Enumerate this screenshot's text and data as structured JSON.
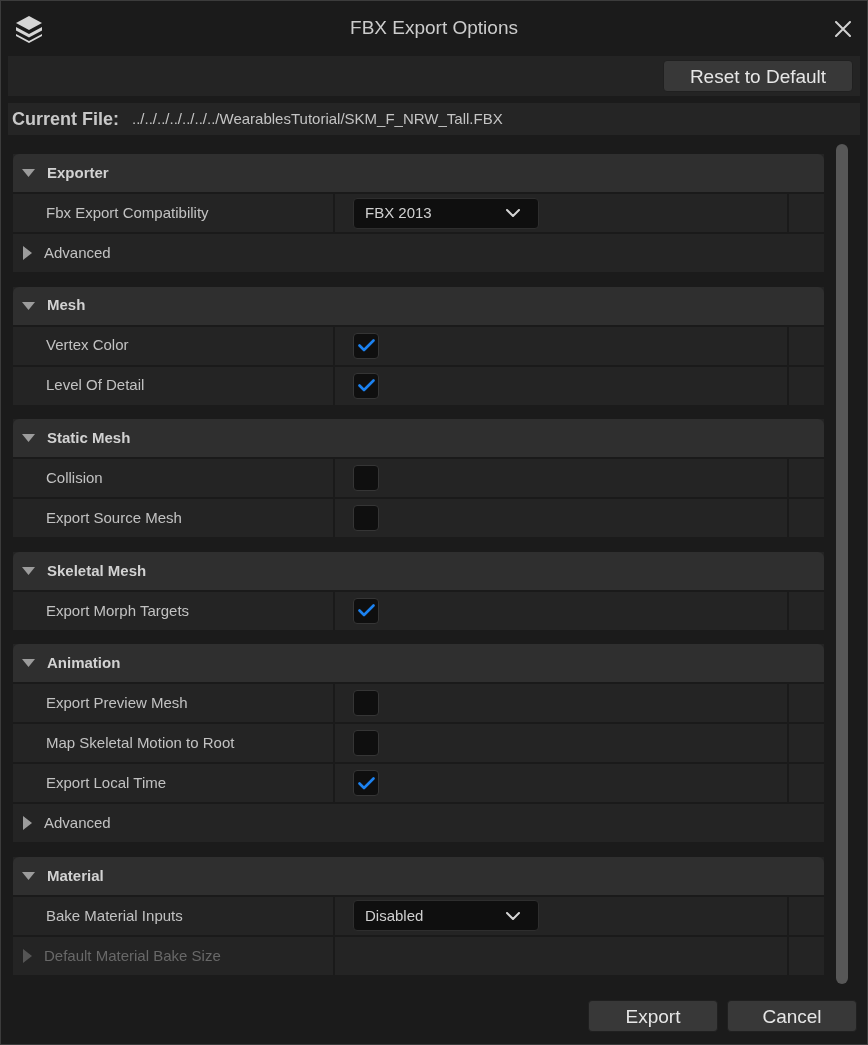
{
  "window": {
    "title": "FBX Export Options"
  },
  "toolbar": {
    "reset_button": "Reset to Default"
  },
  "current_file": {
    "label": "Current File:",
    "path": "../../../../../../../WearablesTutorial/SKM_F_NRW_Tall.FBX"
  },
  "sections": [
    {
      "title": "Exporter",
      "expanded": true,
      "rows": [
        {
          "kind": "dropdown",
          "label": "Fbx Export Compatibility",
          "value": "FBX 2013",
          "disabled": false
        },
        {
          "kind": "category",
          "label": "Advanced",
          "expanded": false,
          "disabled": false
        }
      ]
    },
    {
      "title": "Mesh",
      "expanded": true,
      "rows": [
        {
          "kind": "checkbox",
          "label": "Vertex Color",
          "checked": true,
          "disabled": false
        },
        {
          "kind": "checkbox",
          "label": "Level Of Detail",
          "checked": true,
          "disabled": false
        }
      ]
    },
    {
      "title": "Static Mesh",
      "expanded": true,
      "rows": [
        {
          "kind": "checkbox",
          "label": "Collision",
          "checked": false,
          "disabled": false
        },
        {
          "kind": "checkbox",
          "label": "Export Source Mesh",
          "checked": false,
          "disabled": false
        }
      ]
    },
    {
      "title": "Skeletal Mesh",
      "expanded": true,
      "rows": [
        {
          "kind": "checkbox",
          "label": "Export Morph Targets",
          "checked": true,
          "disabled": false
        }
      ]
    },
    {
      "title": "Animation",
      "expanded": true,
      "rows": [
        {
          "kind": "checkbox",
          "label": "Export Preview Mesh",
          "checked": false,
          "disabled": false
        },
        {
          "kind": "checkbox",
          "label": "Map Skeletal Motion to Root",
          "checked": false,
          "disabled": false
        },
        {
          "kind": "checkbox",
          "label": "Export Local Time",
          "checked": true,
          "disabled": false
        },
        {
          "kind": "category",
          "label": "Advanced",
          "expanded": false,
          "disabled": false
        }
      ]
    },
    {
      "title": "Material",
      "expanded": true,
      "rows": [
        {
          "kind": "dropdown",
          "label": "Bake Material Inputs",
          "value": "Disabled",
          "disabled": false
        },
        {
          "kind": "struct",
          "label": "Default Material Bake Size",
          "expanded": false,
          "disabled": true
        }
      ]
    }
  ],
  "footer_buttons": [
    {
      "label": "Export"
    },
    {
      "label": "Cancel"
    }
  ]
}
